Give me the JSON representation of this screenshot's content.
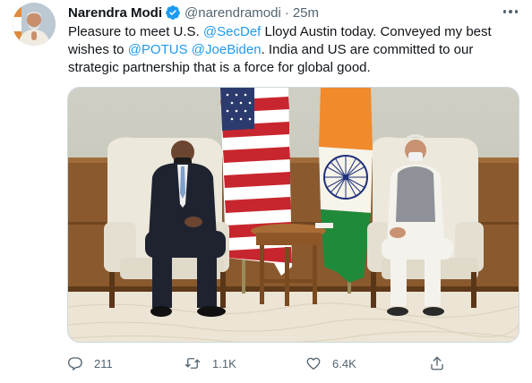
{
  "tweet": {
    "author_name": "Narendra Modi",
    "handle": "@narendramodi",
    "separator": "·",
    "time": "25m",
    "text_segments": [
      {
        "text": "Pleasure to meet U.S. ",
        "type": "text"
      },
      {
        "text": "@SecDef",
        "type": "mention"
      },
      {
        "text": " Lloyd Austin today. Conveyed my best wishes to ",
        "type": "text"
      },
      {
        "text": "@POTUS",
        "type": "mention"
      },
      {
        "text": " ",
        "type": "text"
      },
      {
        "text": "@JoeBiden",
        "type": "mention"
      },
      {
        "text": ". India and US are committed to our strategic partnership that is a force for global good.",
        "type": "text"
      }
    ]
  },
  "actions": {
    "replies": "211",
    "retweets": "1.1K",
    "likes": "6.4K"
  },
  "icons": {
    "verified": "verified-badge-icon",
    "more": "more-options-icon",
    "reply": "reply-icon",
    "retweet": "retweet-icon",
    "like": "heart-icon",
    "share": "share-icon"
  },
  "colors": {
    "accent": "#1d9bf0",
    "text": "#0f1419",
    "secondary": "#536471",
    "border": "#cfd9de"
  }
}
